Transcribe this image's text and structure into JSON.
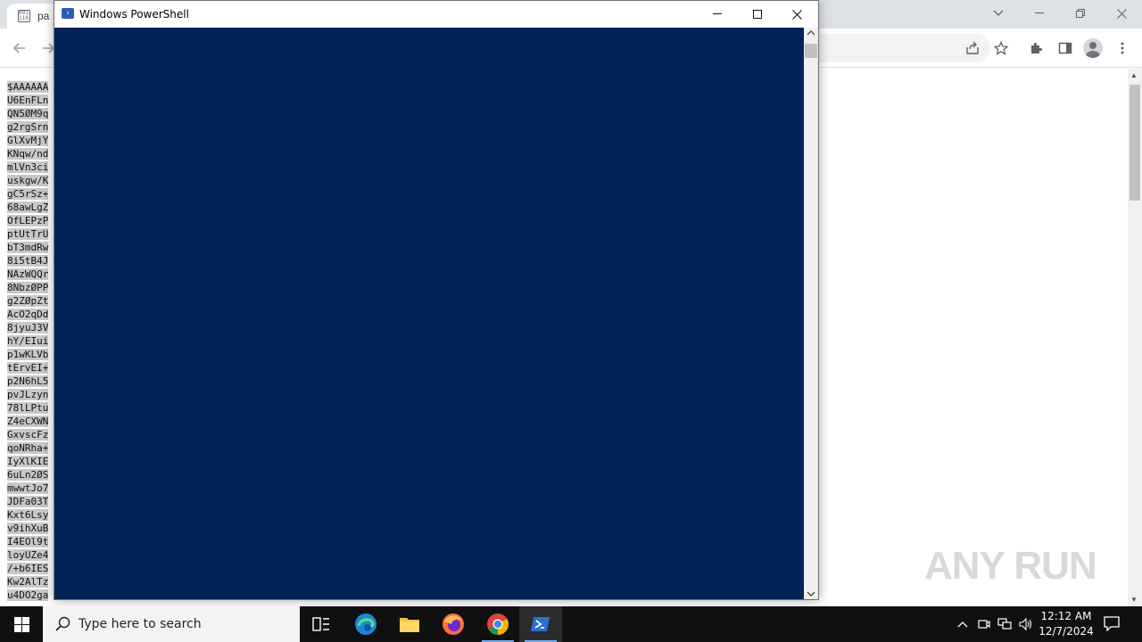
{
  "browser": {
    "tab_title": "pa",
    "favicon_text": "001\n110",
    "page_lines": [
      "$AAAAAA",
      "U6EnFLn",
      "QN5ØM9q",
      "g2rgSrn",
      "GlXvMjY",
      "KNqw/nd",
      "mlVn3ci",
      "uskgw/K",
      "gC5rSz+",
      "68awLgZ",
      "OfLEPzP",
      "ptUtTrU",
      "bT3mdRw",
      "8i5tB4J",
      "NAzWQQr",
      "8NbzØPP",
      "g2ZØpZt",
      "AcO2qDd",
      "8jyuJ3V",
      "hY/EIui",
      "p1wKLVb",
      "tErvEI+",
      "p2N6hL5",
      "pvJLzyn",
      "78lLPtu",
      "Z4eCXWN",
      "GxvscFz",
      "qoNRha+",
      "IyXlKIE",
      "6uLn2ØS",
      "mwwtJo7",
      "JDFa03T",
      "Kxt6Lsy",
      "v9ihXuB",
      "I4EOl9t",
      "loyUZe4",
      "/+b6IES",
      "Kw2AlTz",
      "u4DO2ga"
    ],
    "watermark_text": "ANY RUN"
  },
  "powershell": {
    "title": "Windows PowerShell",
    "console_color": "#012456"
  },
  "taskbar": {
    "search_placeholder": "Type here to search",
    "time": "12:12 AM",
    "date": "12/7/2024",
    "apps": [
      "task-view",
      "edge",
      "file-explorer",
      "firefox",
      "chrome",
      "powershell"
    ]
  }
}
